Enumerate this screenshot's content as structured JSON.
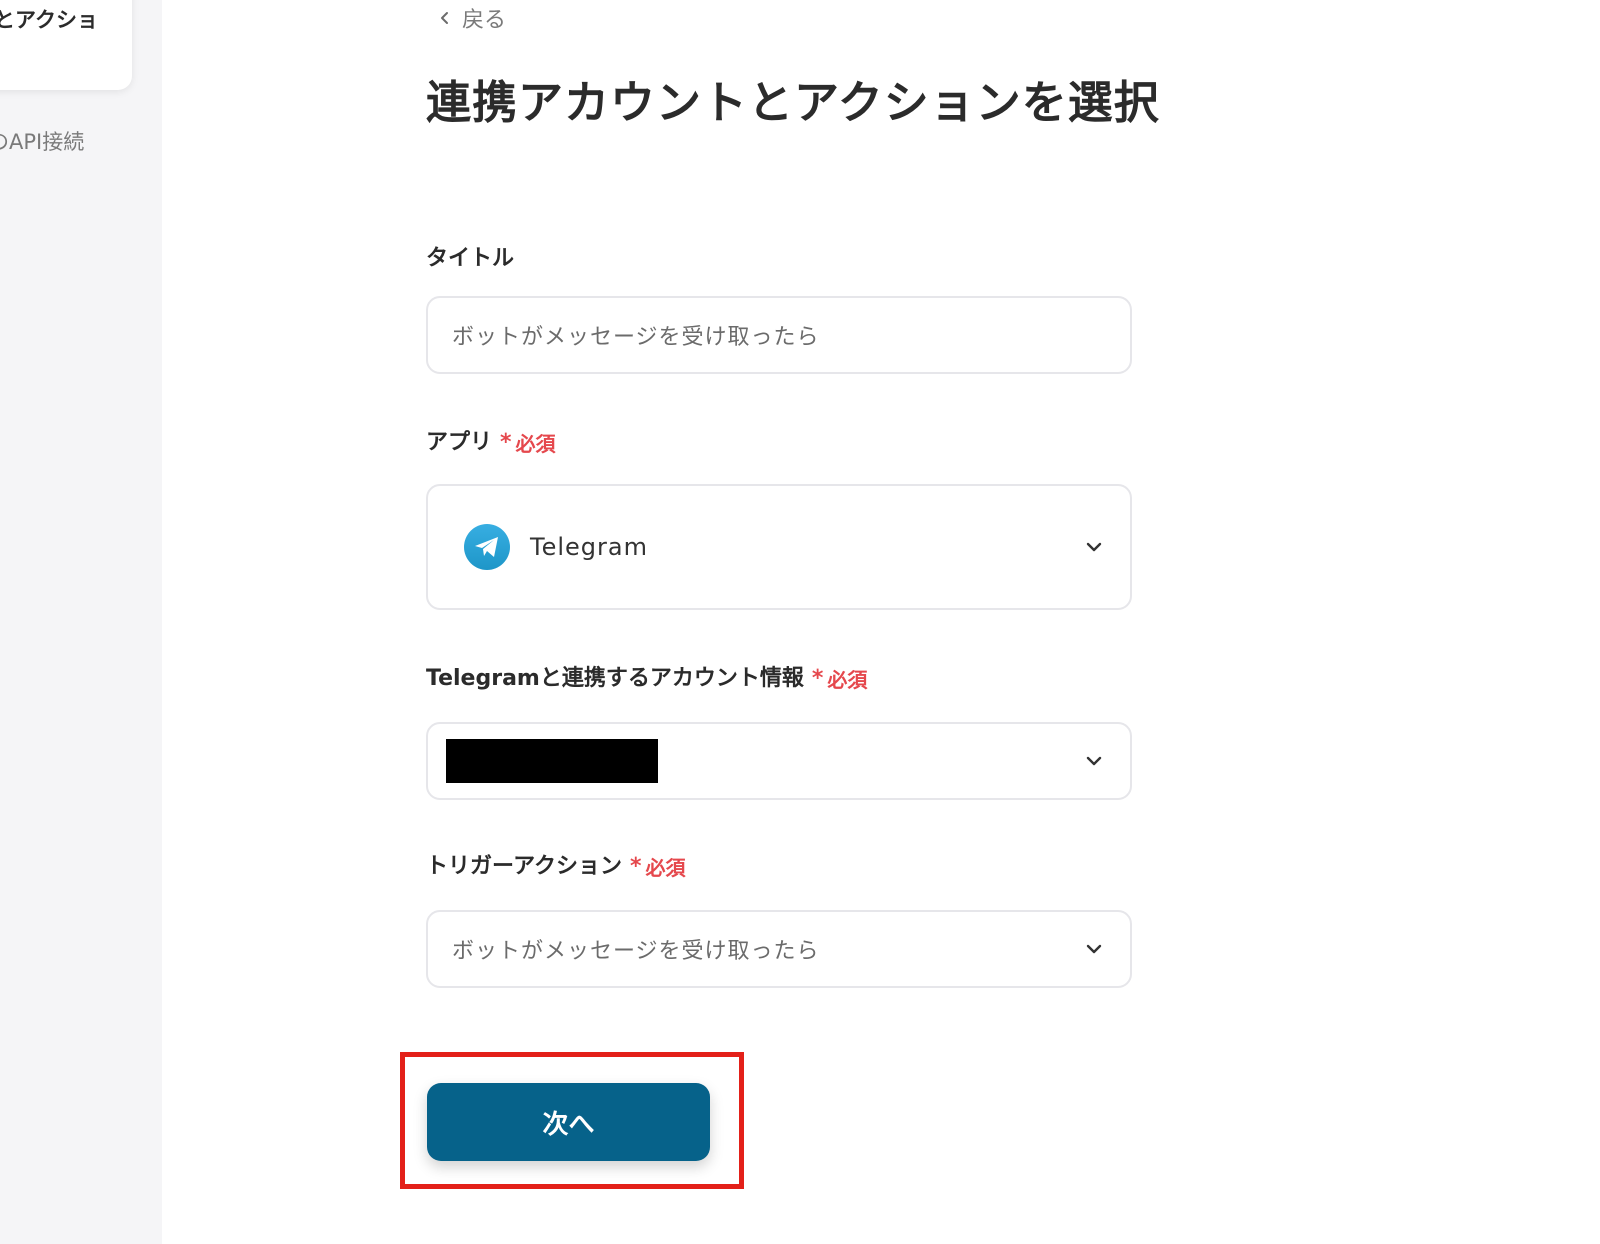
{
  "sidebar": {
    "card_label": "とアクショ",
    "link_label": "のAPI接続"
  },
  "back": {
    "label": "戻る"
  },
  "page_title": "連携アカウントとアクションを選択",
  "required_label": "必須",
  "required_mark": "*",
  "fields": {
    "title": {
      "label": "タイトル",
      "value": "ボットがメッセージを受け取ったら"
    },
    "app": {
      "label": "アプリ",
      "value": "Telegram",
      "icon": "telegram-icon"
    },
    "account": {
      "label": "Telegramと連携するアカウント情報",
      "value": ""
    },
    "trigger": {
      "label": "トリガーアクション",
      "value": "ボットがメッセージを受け取ったら"
    }
  },
  "next_button": {
    "label": "次へ"
  },
  "colors": {
    "primary": "#06628a",
    "required": "#e5484d",
    "highlight": "#e32019",
    "telegram": "#2ba5e0"
  }
}
